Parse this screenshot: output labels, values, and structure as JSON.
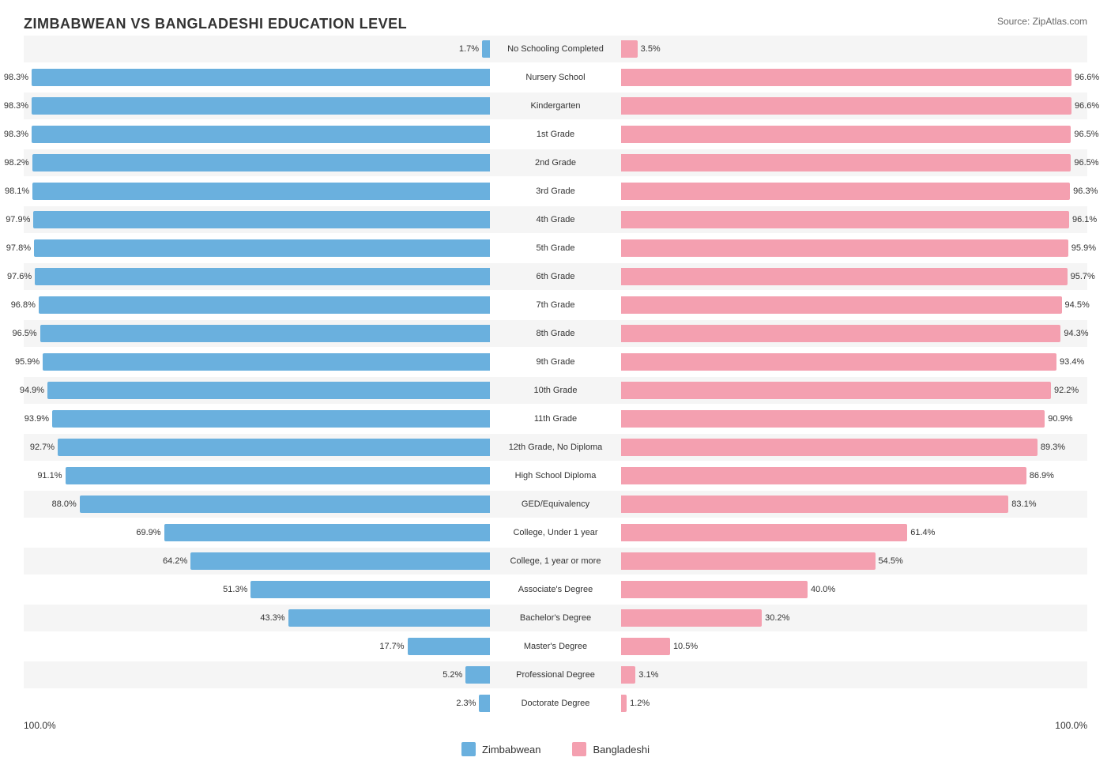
{
  "title": "ZIMBABWEAN VS BANGLADESHI EDUCATION LEVEL",
  "source": "Source: ZipAtlas.com",
  "colors": {
    "blue": "#6ab0de",
    "pink": "#f4a0b0",
    "bg_odd": "#f5f5f5",
    "bg_even": "#ffffff"
  },
  "legend": {
    "zimbabwean": "Zimbabwean",
    "bangladeshi": "Bangladeshi"
  },
  "axis": {
    "left": "100.0%",
    "right": "100.0%"
  },
  "rows": [
    {
      "label": "No Schooling Completed",
      "left_pct": 1.7,
      "right_pct": 3.5,
      "left_val": "1.7%",
      "right_val": "3.5%"
    },
    {
      "label": "Nursery School",
      "left_pct": 98.3,
      "right_pct": 96.6,
      "left_val": "98.3%",
      "right_val": "96.6%"
    },
    {
      "label": "Kindergarten",
      "left_pct": 98.3,
      "right_pct": 96.6,
      "left_val": "98.3%",
      "right_val": "96.6%"
    },
    {
      "label": "1st Grade",
      "left_pct": 98.3,
      "right_pct": 96.5,
      "left_val": "98.3%",
      "right_val": "96.5%"
    },
    {
      "label": "2nd Grade",
      "left_pct": 98.2,
      "right_pct": 96.5,
      "left_val": "98.2%",
      "right_val": "96.5%"
    },
    {
      "label": "3rd Grade",
      "left_pct": 98.1,
      "right_pct": 96.3,
      "left_val": "98.1%",
      "right_val": "96.3%"
    },
    {
      "label": "4th Grade",
      "left_pct": 97.9,
      "right_pct": 96.1,
      "left_val": "97.9%",
      "right_val": "96.1%"
    },
    {
      "label": "5th Grade",
      "left_pct": 97.8,
      "right_pct": 95.9,
      "left_val": "97.8%",
      "right_val": "95.9%"
    },
    {
      "label": "6th Grade",
      "left_pct": 97.6,
      "right_pct": 95.7,
      "left_val": "97.6%",
      "right_val": "95.7%"
    },
    {
      "label": "7th Grade",
      "left_pct": 96.8,
      "right_pct": 94.5,
      "left_val": "96.8%",
      "right_val": "94.5%"
    },
    {
      "label": "8th Grade",
      "left_pct": 96.5,
      "right_pct": 94.3,
      "left_val": "96.5%",
      "right_val": "94.3%"
    },
    {
      "label": "9th Grade",
      "left_pct": 95.9,
      "right_pct": 93.4,
      "left_val": "95.9%",
      "right_val": "93.4%"
    },
    {
      "label": "10th Grade",
      "left_pct": 94.9,
      "right_pct": 92.2,
      "left_val": "94.9%",
      "right_val": "92.2%"
    },
    {
      "label": "11th Grade",
      "left_pct": 93.9,
      "right_pct": 90.9,
      "left_val": "93.9%",
      "right_val": "90.9%"
    },
    {
      "label": "12th Grade, No Diploma",
      "left_pct": 92.7,
      "right_pct": 89.3,
      "left_val": "92.7%",
      "right_val": "89.3%"
    },
    {
      "label": "High School Diploma",
      "left_pct": 91.1,
      "right_pct": 86.9,
      "left_val": "91.1%",
      "right_val": "86.9%"
    },
    {
      "label": "GED/Equivalency",
      "left_pct": 88.0,
      "right_pct": 83.1,
      "left_val": "88.0%",
      "right_val": "83.1%"
    },
    {
      "label": "College, Under 1 year",
      "left_pct": 69.9,
      "right_pct": 61.4,
      "left_val": "69.9%",
      "right_val": "61.4%"
    },
    {
      "label": "College, 1 year or more",
      "left_pct": 64.2,
      "right_pct": 54.5,
      "left_val": "64.2%",
      "right_val": "54.5%"
    },
    {
      "label": "Associate's Degree",
      "left_pct": 51.3,
      "right_pct": 40.0,
      "left_val": "51.3%",
      "right_val": "40.0%"
    },
    {
      "label": "Bachelor's Degree",
      "left_pct": 43.3,
      "right_pct": 30.2,
      "left_val": "43.3%",
      "right_val": "30.2%"
    },
    {
      "label": "Master's Degree",
      "left_pct": 17.7,
      "right_pct": 10.5,
      "left_val": "17.7%",
      "right_val": "10.5%"
    },
    {
      "label": "Professional Degree",
      "left_pct": 5.2,
      "right_pct": 3.1,
      "left_val": "5.2%",
      "right_val": "3.1%"
    },
    {
      "label": "Doctorate Degree",
      "left_pct": 2.3,
      "right_pct": 1.2,
      "left_val": "2.3%",
      "right_val": "1.2%"
    }
  ]
}
